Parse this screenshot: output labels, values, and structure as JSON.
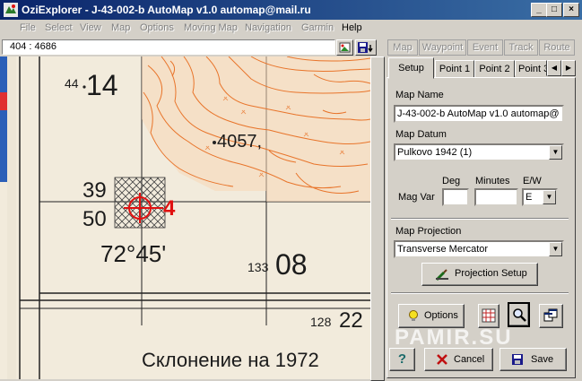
{
  "window": {
    "title": "OziExplorer - J-43-002-b AutoMap v1.0 automap@mail.ru",
    "min_label": "_",
    "max_label": "□",
    "close_label": "×"
  },
  "menu": [
    "File",
    "Select",
    "View",
    "Map",
    "Options",
    "Moving Map",
    "Navigation",
    "Garmin",
    "Help"
  ],
  "toolbar": {
    "coordinates": "404 : 4686"
  },
  "top_tabs": [
    "Map",
    "Waypoint",
    "Event",
    "Track",
    "Route"
  ],
  "inner_tabs": [
    "Setup",
    "Point 1",
    "Point 2",
    "Point 3"
  ],
  "setup": {
    "map_name_label": "Map Name",
    "map_name_value": "J-43-002-b AutoMap v1.0 automap@",
    "map_datum_label": "Map Datum",
    "map_datum_value": "Pulkovo 1942 (1)",
    "deg_label": "Deg",
    "minutes_label": "Minutes",
    "ew_label": "E/W",
    "mag_var_label": "Mag Var",
    "deg_value": "",
    "minutes_value": "",
    "ew_value": "E",
    "map_projection_label": "Map Projection",
    "map_projection_value": "Transverse Mercator",
    "projection_setup_label": "Projection Setup",
    "options_label": "Options",
    "help_label": "?",
    "cancel_label": "Cancel",
    "save_label": "Save"
  },
  "map_labels": {
    "spot_44": "44",
    "grid_14": "14",
    "elev": "4057,",
    "deg39": "39",
    "deg50": "50",
    "lon": "72°45'",
    "small133": "133",
    "grid08": "08",
    "small128": "128",
    "grid22": "22",
    "marker4": "4",
    "caption": "Склонение на 1972"
  },
  "watermark": "PAMIR.SU",
  "colors": {
    "contour": "#e8742a",
    "marker": "#e01010",
    "title_start": "#0a246a",
    "title_end": "#3a6ea5"
  }
}
